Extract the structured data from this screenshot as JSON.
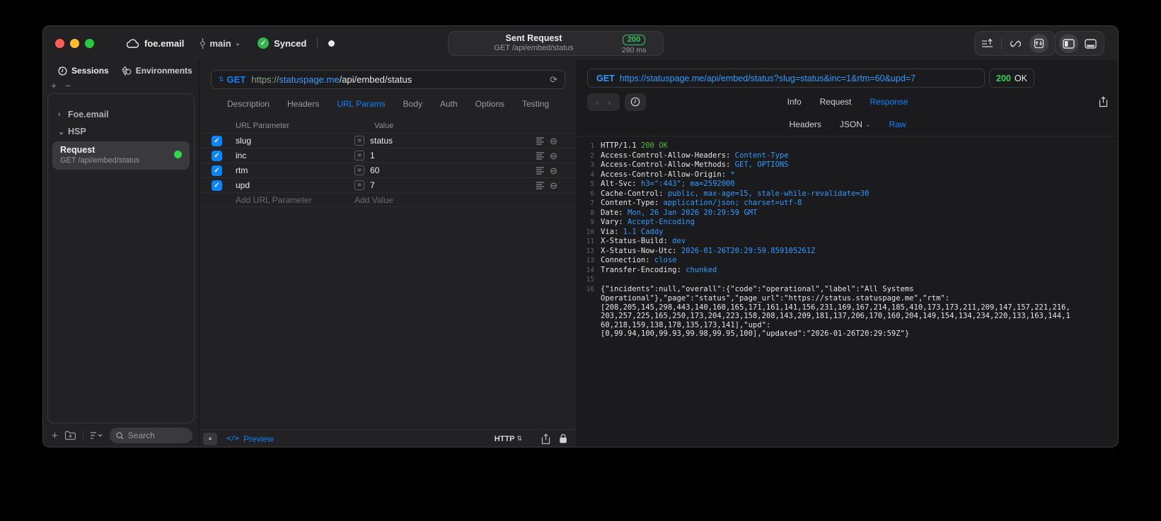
{
  "titlebar": {
    "project": "foe.email",
    "branch": "main",
    "sync_label": "Synced",
    "sent": {
      "title": "Sent Request",
      "subtitle": "GET /api/embed/status",
      "code": "200",
      "time": "280 ms"
    }
  },
  "sidebar": {
    "tab_sessions": "Sessions",
    "tab_environments": "Environments",
    "groups": [
      {
        "label": "Foe.email",
        "expanded": false
      },
      {
        "label": "HSP",
        "expanded": true
      }
    ],
    "request": {
      "title": "Request",
      "subtitle": "GET /api/embed/status"
    },
    "search_placeholder": "Search"
  },
  "request_editor": {
    "method": "GET",
    "url": {
      "scheme": "https://",
      "host": "statuspage.me",
      "path": "/api/embed/status"
    },
    "tabs": [
      "Description",
      "Headers",
      "URL Params",
      "Body",
      "Auth",
      "Options",
      "Testing"
    ],
    "active_tab": "URL Params",
    "params_table": {
      "columns": [
        "URL Parameter",
        "Value"
      ],
      "rows": [
        {
          "name": "slug",
          "value": "status",
          "checked": true
        },
        {
          "name": "inc",
          "value": "1",
          "checked": true
        },
        {
          "name": "rtm",
          "value": "60",
          "checked": true
        },
        {
          "name": "upd",
          "value": "7",
          "checked": true
        }
      ],
      "add_row": {
        "name": "Add URL Parameter",
        "value": "Add Value"
      }
    },
    "footer": {
      "code_glyph": "</>",
      "preview": "Preview",
      "protocol": "HTTP"
    }
  },
  "response_viewer": {
    "method": "GET",
    "request_line": "https://statuspage.me/api/embed/status?slug=status&inc=1&rtm=60&upd=7",
    "status_code": "200",
    "status_text": "OK",
    "tabs": [
      "Info",
      "Request",
      "Response"
    ],
    "active_tab": "Response",
    "subtabs": [
      "Headers",
      "JSON",
      "Raw"
    ],
    "active_subtab": "Raw",
    "http_version": "HTTP/1.1",
    "status_line": "200 OK",
    "headers": [
      {
        "name": "Access-Control-Allow-Headers",
        "value": "Content-Type"
      },
      {
        "name": "Access-Control-Allow-Methods",
        "value": "GET, OPTIONS"
      },
      {
        "name": "Access-Control-Allow-Origin",
        "value": "*"
      },
      {
        "name": "Alt-Svc",
        "value": "h3=\":443\"; ma=2592000"
      },
      {
        "name": "Cache-Control",
        "value": "public, max-age=15, stale-while-revalidate=30"
      },
      {
        "name": "Content-Type",
        "value": "application/json; charset=utf-8"
      },
      {
        "name": "Date",
        "value": "Mon, 26 Jan 2026 20:29:59 GMT"
      },
      {
        "name": "Vary",
        "value": "Accept-Encoding"
      },
      {
        "name": "Via",
        "value": "1.1 Caddy"
      },
      {
        "name": "X-Status-Build",
        "value": "dev"
      },
      {
        "name": "X-Status-Now-Utc",
        "value": "2026-01-26T20:29:59.859105261Z"
      },
      {
        "name": "Connection",
        "value": "close"
      },
      {
        "name": "Transfer-Encoding",
        "value": "chunked"
      }
    ],
    "blank_line_number": 15,
    "body_line_number": 16,
    "body_lines": [
      "{\"incidents\":null,\"overall\":{\"code\":\"operational\",\"label\":\"All Systems",
      "Operational\"},\"page\":\"status\",\"page_url\":\"https://status.statuspage.me\",\"rtm\":",
      "[208,205,145,298,443,140,160,165,171,161,141,156,231,169,167,214,185,410,173,173,211,209,147,157,221,216,",
      "203,257,225,165,250,173,204,223,158,208,143,209,181,137,206,170,160,204,149,154,134,234,220,133,163,144,1",
      "60,218,159,138,178,135,173,141],\"upd\":",
      "[0,99.94,100,99.93,99.98,99.95,100],\"updated\":\"2026-01-26T20:29:59Z\"}"
    ]
  },
  "glyphs": {
    "chevron_right": "›",
    "chevron_down": "⌄",
    "plus": "+",
    "minus": "−",
    "up_down": "⇅",
    "back": "‹",
    "forward": "›",
    "refresh": "⟳",
    "equals": "=",
    "minus_circle": "⊖",
    "collapse": "▲",
    "check": "✓"
  },
  "colors": {
    "accent_blue": "#0a84ff",
    "value_blue": "#2e9bff",
    "status_green": "#30d158",
    "badge_green": "#34c759",
    "code_green": "#57b33a"
  }
}
